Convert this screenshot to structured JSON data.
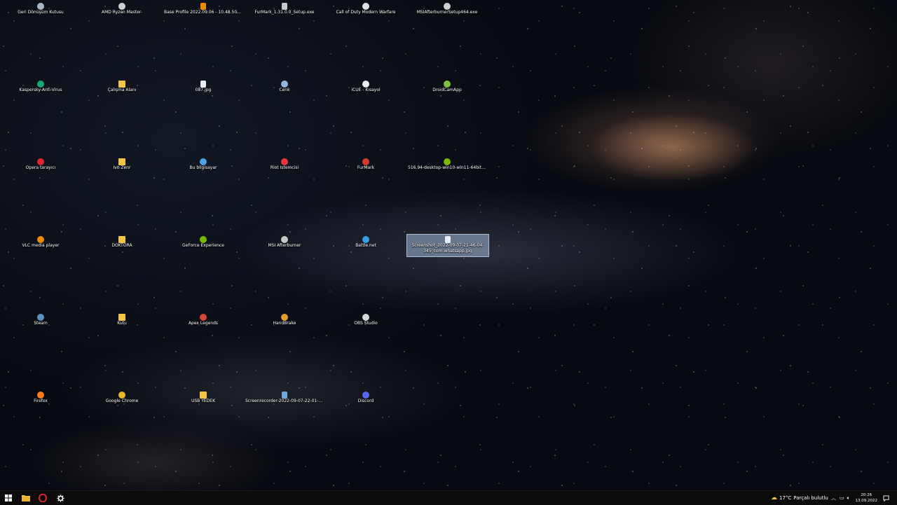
{
  "desktop": {
    "icons": [
      {
        "label": "Geri Dönüşüm Kutusu",
        "icon": "recycle-bin-icon",
        "color": "#a9b8c8"
      },
      {
        "label": "AMD Ryzen Master-",
        "icon": "amd-ryzen-icon",
        "color": "#d0d0d0"
      },
      {
        "label": "Base Profile 2022.09.06 - 10.48.50.01.m4v",
        "icon": "vlc-video-file-icon",
        "color": "#f08a00"
      },
      {
        "label": "FurMark_1.31.0.0_Setup.exe",
        "icon": "setup-exe-icon",
        "color": "#c9c9c9"
      },
      {
        "label": "Call of Duty Modern Warfare",
        "icon": "cod-icon",
        "color": "#e0e0e0"
      },
      {
        "label": "MSIAfterburnerSetup464.exe",
        "icon": "msi-afterburner-setup-icon",
        "color": "#cfcfcf"
      },
      {
        "label": "Kaspersky-Anti-Virus",
        "icon": "kaspersky-icon",
        "color": "#19a974"
      },
      {
        "label": "Çalışma Alanı",
        "icon": "folder-icon",
        "color": "#f5c542"
      },
      {
        "label": "087.jpg",
        "icon": "image-file-icon",
        "color": "#e8eef5"
      },
      {
        "label": "Cenk",
        "icon": "user-folder-icon",
        "color": "#8fb7e0"
      },
      {
        "label": "iCUE - Kısayol",
        "icon": "icue-icon",
        "color": "#f0f0f0"
      },
      {
        "label": "DroidCamApp",
        "icon": "droidcam-icon",
        "color": "#7cc242"
      },
      {
        "label": "Opera tarayıcı",
        "icon": "opera-icon",
        "color": "#e0262c"
      },
      {
        "label": "Ivo Zenr",
        "icon": "folder-icon",
        "color": "#f5c542"
      },
      {
        "label": "Bu bilgisayar",
        "icon": "this-pc-icon",
        "color": "#4ea3e8"
      },
      {
        "label": "Riot İstemcisi",
        "icon": "riot-client-icon",
        "color": "#e8383d"
      },
      {
        "label": "FurMark",
        "icon": "furmark-icon",
        "color": "#d63a2e"
      },
      {
        "label": "516.94-desktop-win10-win11-64bit-inter...",
        "icon": "nvidia-driver-icon",
        "color": "#76b900"
      },
      {
        "label": "VLC media player",
        "icon": "vlc-icon",
        "color": "#f08a00"
      },
      {
        "label": "DOKTORA",
        "icon": "folder-icon",
        "color": "#f5c542"
      },
      {
        "label": "GeForce Experience",
        "icon": "geforce-icon",
        "color": "#76b900"
      },
      {
        "label": "MSI Afterburner",
        "icon": "msi-afterburner-icon",
        "color": "#c7c7c7"
      },
      {
        "label": "Battle.net",
        "icon": "battlenet-icon",
        "color": "#3b9ce6"
      },
      {
        "label": "Screenshot_2022-09-07-21-46-04-345_com.whatsapp.jpg",
        "icon": "image-file-icon",
        "color": "#e8eef5",
        "selected": true
      },
      {
        "label": "Steam",
        "icon": "steam-icon",
        "color": "#5f8fbf"
      },
      {
        "label": "Kutu",
        "icon": "folder-icon",
        "color": "#f5c542"
      },
      {
        "label": "Apex Legends",
        "icon": "apex-icon",
        "color": "#d9413b"
      },
      {
        "label": "HandBrake",
        "icon": "handbrake-icon",
        "color": "#e49a2d"
      },
      {
        "label": "OBS Studio",
        "icon": "obs-icon",
        "color": "#d8d8d8"
      },
      {
        "label": "Firefox",
        "icon": "firefox-icon",
        "color": "#ff7b1c"
      },
      {
        "label": "Google Chrome",
        "icon": "chrome-icon",
        "color": "#e6b82a"
      },
      {
        "label": "USB YEDEK",
        "icon": "folder-icon",
        "color": "#f5c542"
      },
      {
        "label": "Screenrecorder-2022-09-07-22-01-24-19...",
        "icon": "video-file-icon",
        "color": "#6fa8dc"
      },
      {
        "label": "Discord",
        "icon": "discord-icon",
        "color": "#5865f2"
      }
    ]
  },
  "taskbar": {
    "pinned": [
      {
        "name": "start-button",
        "icon": "windows-logo-icon"
      },
      {
        "name": "file-explorer-button",
        "icon": "folder-icon"
      },
      {
        "name": "opera-taskbar-button",
        "icon": "opera-icon"
      },
      {
        "name": "settings-taskbar-button",
        "icon": "gear-icon"
      }
    ],
    "weather": {
      "temp": "17°C",
      "text": "Parçalı bulutlu"
    },
    "time": "20:26",
    "date": "13.09.2022"
  }
}
